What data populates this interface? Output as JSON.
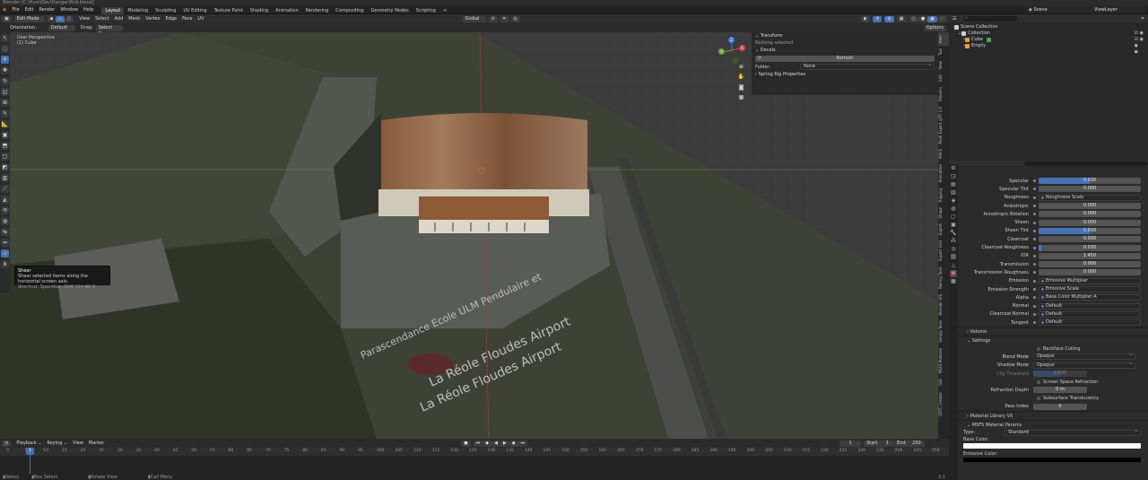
{
  "title_bar": {
    "text": "Blender [C:\\Hum\\Dev\\Hangar\\Ridi.blend]"
  },
  "menu": [
    "File",
    "Edit",
    "Render",
    "Window",
    "Help"
  ],
  "workspaces": [
    "Layout",
    "Modeling",
    "Sculpting",
    "UV Editing",
    "Texture Paint",
    "Shading",
    "Animation",
    "Rendering",
    "Compositing",
    "Geometry Nodes",
    "Scripting"
  ],
  "active_workspace": "Layout",
  "scene": {
    "label": "Scene",
    "view_layer": "ViewLayer"
  },
  "viewport_header": {
    "mode": "Edit Mode",
    "menus": [
      "View",
      "Select",
      "Add",
      "Mesh",
      "Vertex",
      "Edge",
      "Face",
      "UV"
    ],
    "transform": "Global"
  },
  "tool_header": {
    "orientation_label": "Orientation:",
    "orientation_value": "Default",
    "drag_label": "Drag:",
    "drag_value": "Select Box",
    "options": "Options"
  },
  "viewport_info": {
    "line1": "User Perspective",
    "line2": "(1) Cube"
  },
  "gizmo": {
    "x": "X",
    "y": "Y",
    "z": "Z"
  },
  "n_panel": {
    "transform_title": "Transform",
    "nothing_selected": "Nothing selected",
    "decals_title": "Decals",
    "refresh": "Refresh",
    "folder_label": "Folder:",
    "folder_value": "None",
    "spring_rig": "Spring Rig Properties"
  },
  "side_tabs": [
    "Item",
    "Tool",
    "View",
    "Edit",
    "Mixamo",
    "Multi Export glTF 2.0",
    "MSFS",
    "Animation",
    "Rigging",
    "Shape",
    "Export",
    "Export Grid",
    "Baking Tools",
    "Blender GIS",
    "Simply Tools",
    "MSFS Material",
    "CDE",
    "ORTC Creator"
  ],
  "tooltip": {
    "title": "Shear",
    "desc": "Shear selected items along the horizontal screen axis.",
    "shortcut": "Shortcut: Spacebar, Shift Ctrl Alt S"
  },
  "map_labels": [
    "Parascendance Ecole ULM Pendulaire et",
    "La Réole Floudes Airport",
    "La Réole Floudes Airport"
  ],
  "outliner": {
    "items": [
      {
        "label": "Scene Collection",
        "depth": 0
      },
      {
        "label": "Collection",
        "depth": 1
      },
      {
        "label": "Cube",
        "depth": 2
      },
      {
        "label": "Empty",
        "depth": 2
      }
    ]
  },
  "properties": {
    "rows": [
      {
        "label": "Specular",
        "kind": "slider",
        "value": "0.500",
        "fill": 0.5
      },
      {
        "label": "Specular Tint",
        "kind": "slider",
        "value": "0.000",
        "fill": 0
      },
      {
        "label": "Roughness",
        "kind": "socket",
        "value": "Roughness Scale"
      },
      {
        "label": "Anisotropic",
        "kind": "slider",
        "value": "0.000",
        "fill": 0
      },
      {
        "label": "Anisotropic Rotation",
        "kind": "slider",
        "value": "0.000",
        "fill": 0
      },
      {
        "label": "Sheen",
        "kind": "slider",
        "value": "0.000",
        "fill": 0
      },
      {
        "label": "Sheen Tint",
        "kind": "slider",
        "value": "0.500",
        "fill": 0.5
      },
      {
        "label": "Clearcoat",
        "kind": "slider",
        "value": "0.000",
        "fill": 0
      },
      {
        "label": "Clearcoat Roughness",
        "kind": "slider",
        "value": "0.030",
        "fill": 0.03
      },
      {
        "label": "IOR",
        "kind": "slider",
        "value": "1.450",
        "fill": 0
      },
      {
        "label": "Transmission",
        "kind": "slider",
        "value": "0.000",
        "fill": 0
      },
      {
        "label": "Transmission Roughness",
        "kind": "slider",
        "value": "0.000",
        "fill": 0
      },
      {
        "label": "Emission",
        "kind": "socket",
        "value": "Emissive Multiplier"
      },
      {
        "label": "Emission Strength",
        "kind": "socket",
        "value": "Emissive Scale"
      },
      {
        "label": "Alpha",
        "kind": "socket",
        "value": "Base Color Multiplier A"
      },
      {
        "label": "Normal",
        "kind": "socket",
        "value": "Default"
      },
      {
        "label": "Clearcoat Normal",
        "kind": "socket",
        "value": "Default"
      },
      {
        "label": "Tangent",
        "kind": "socket",
        "value": "Default"
      }
    ],
    "volume": "Volume",
    "settings": "Settings",
    "backface": "Backface Culling",
    "blend_mode_label": "Blend Mode",
    "blend_mode": "Opaque",
    "shadow_mode_label": "Shadow Mode",
    "shadow_mode": "Opaque",
    "clip_label": "Clip Threshold",
    "clip_value": "0.500",
    "ssr": "Screen Space Refraction",
    "refr_depth_label": "Refraction Depth",
    "refr_depth": "0 m",
    "sss": "Subsurface Translucency",
    "pass_label": "Pass Index",
    "pass_value": "0",
    "library": "Material Library VX",
    "msfs": "MSFS Material Params",
    "type_label": "Type:",
    "type_value": "Standard",
    "base_color_label": "Base Color:",
    "emissive_label": "Emissive Color:"
  },
  "timeline": {
    "menus": [
      "Playback",
      "Keying",
      "View",
      "Marker"
    ],
    "current": "1",
    "start_label": "Start",
    "start": "1",
    "end_label": "End",
    "end": "250",
    "ticks": [
      "0",
      "5",
      "10",
      "15",
      "20",
      "25",
      "30",
      "35",
      "40",
      "45",
      "50",
      "55",
      "60",
      "65",
      "70",
      "75",
      "80",
      "85",
      "90",
      "95",
      "100",
      "105",
      "110",
      "115",
      "120",
      "125",
      "130",
      "135",
      "140",
      "145",
      "150",
      "155",
      "160",
      "165",
      "170",
      "175",
      "180",
      "185",
      "190",
      "195",
      "200",
      "205",
      "210",
      "215",
      "220",
      "225",
      "230",
      "235",
      "240",
      "245",
      "250"
    ]
  },
  "status": {
    "select": "Select",
    "box": "Box Select",
    "rotate": "Rotate View",
    "call": "Call Menu",
    "version": "3.1"
  },
  "colors": {
    "accent": "#4772b3",
    "x_axis": "#d6414e",
    "y_axis": "#6fa83a",
    "z_axis": "#3e7ee0"
  }
}
